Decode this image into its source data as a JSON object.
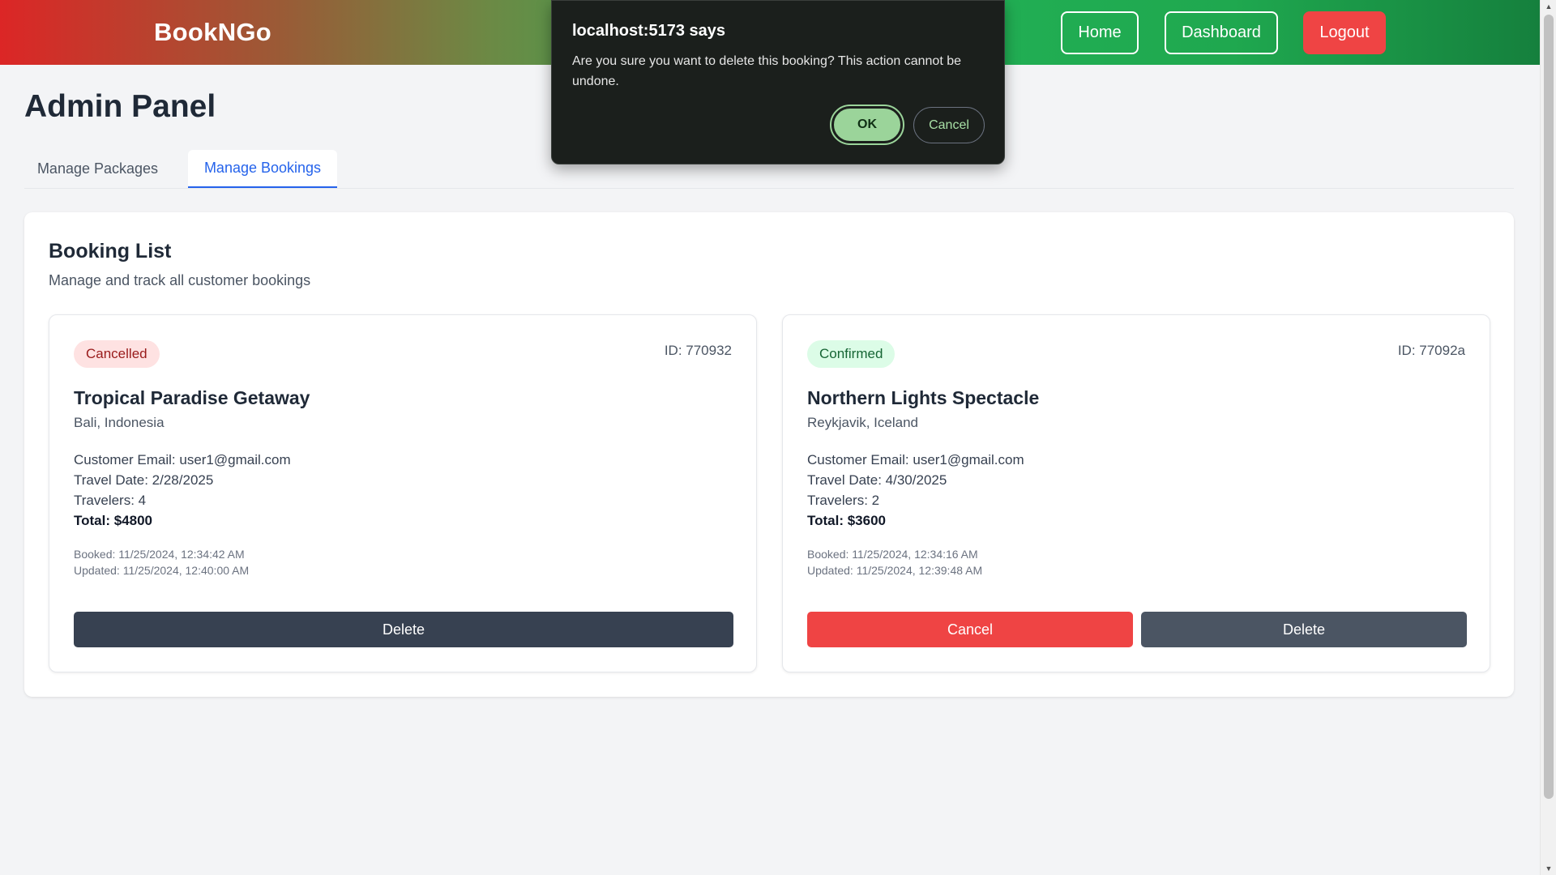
{
  "navbar": {
    "brand": "BookNGo",
    "links": {
      "home": "Home",
      "dashboard": "Dashboard",
      "logout": "Logout"
    },
    "colors": {
      "gradient_start": "#dc2626",
      "gradient_end": "#15803d",
      "logout_bg": "#ef4444"
    }
  },
  "page": {
    "title": "Admin Panel",
    "tabs": {
      "packages": "Manage Packages",
      "bookings": "Manage Bookings",
      "active": "Manage Bookings"
    }
  },
  "booking_list": {
    "title": "Booking List",
    "subtitle": "Manage and track all customer bookings",
    "cards": [
      {
        "status": "Cancelled",
        "id": "ID: 770932",
        "title": "Tropical Paradise Getaway",
        "location": "Bali, Indonesia",
        "email": "Customer Email: user1@gmail.com",
        "travel_date": "Travel Date: 2/28/2025",
        "travelers": "Travelers: 4",
        "total": "Total: $4800",
        "booked": "Booked: 11/25/2024, 12:34:42 AM",
        "updated": "Updated: 11/25/2024, 12:40:00 AM",
        "delete_label": "Delete"
      },
      {
        "status": "Confirmed",
        "id": "ID: 77092a",
        "title": "Northern Lights Spectacle",
        "location": "Reykjavik, Iceland",
        "email": "Customer Email: user1@gmail.com",
        "travel_date": "Travel Date: 4/30/2025",
        "travelers": "Travelers: 2",
        "total": "Total: $3600",
        "booked": "Booked: 11/25/2024, 12:34:16 AM",
        "updated": "Updated: 11/25/2024, 12:39:48 AM",
        "cancel_label": "Cancel",
        "delete_label": "Delete"
      }
    ]
  },
  "dialog": {
    "title": "localhost:5173 says",
    "message": "Are you sure you want to delete this booking? This action cannot be undone.",
    "ok_label": "OK",
    "cancel_label": "Cancel"
  },
  "scrollbar": {
    "up_icon": "▲",
    "down_icon": "▼"
  }
}
